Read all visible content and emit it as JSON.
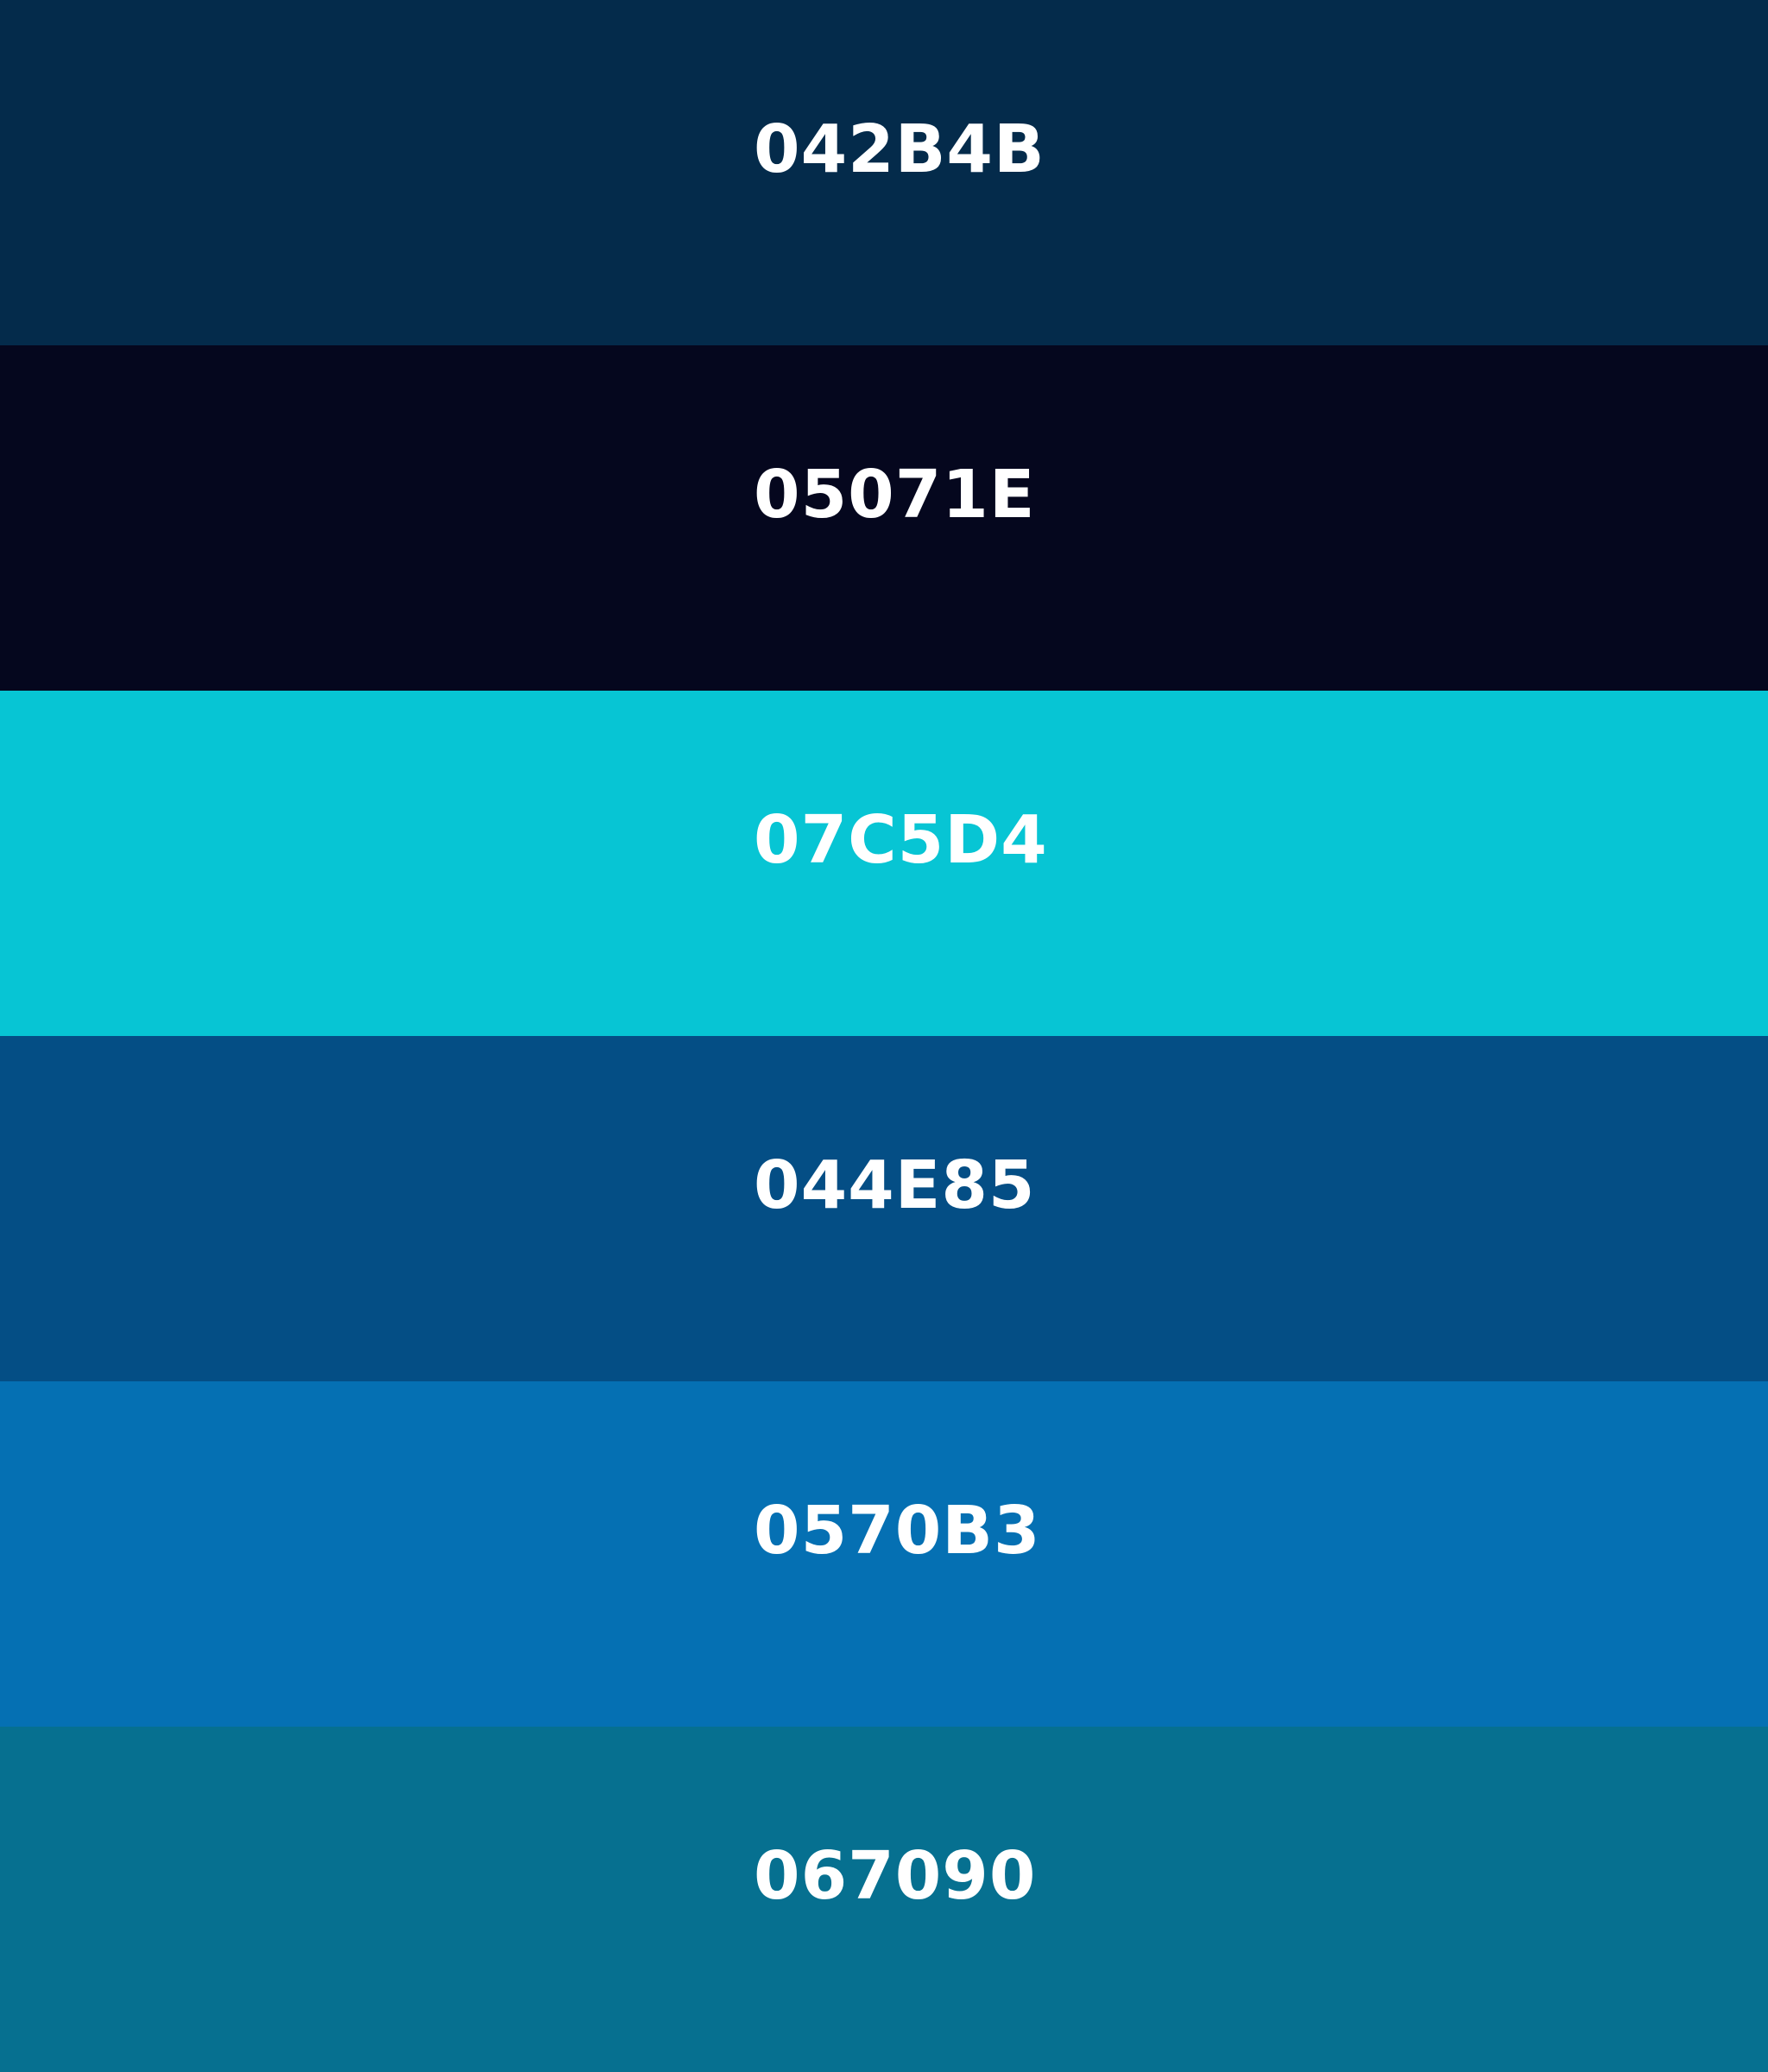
{
  "swatches": [
    {
      "label": "042B4B",
      "color": "#042B4B"
    },
    {
      "label": "05071E",
      "color": "#05071E"
    },
    {
      "label": "07C5D4",
      "color": "#07C5D4"
    },
    {
      "label": "044E85",
      "color": "#044E85"
    },
    {
      "label": "0570B3",
      "color": "#0570B3"
    },
    {
      "label": "067090",
      "color": "#067090"
    }
  ],
  "text_color": "#FFFFFF"
}
